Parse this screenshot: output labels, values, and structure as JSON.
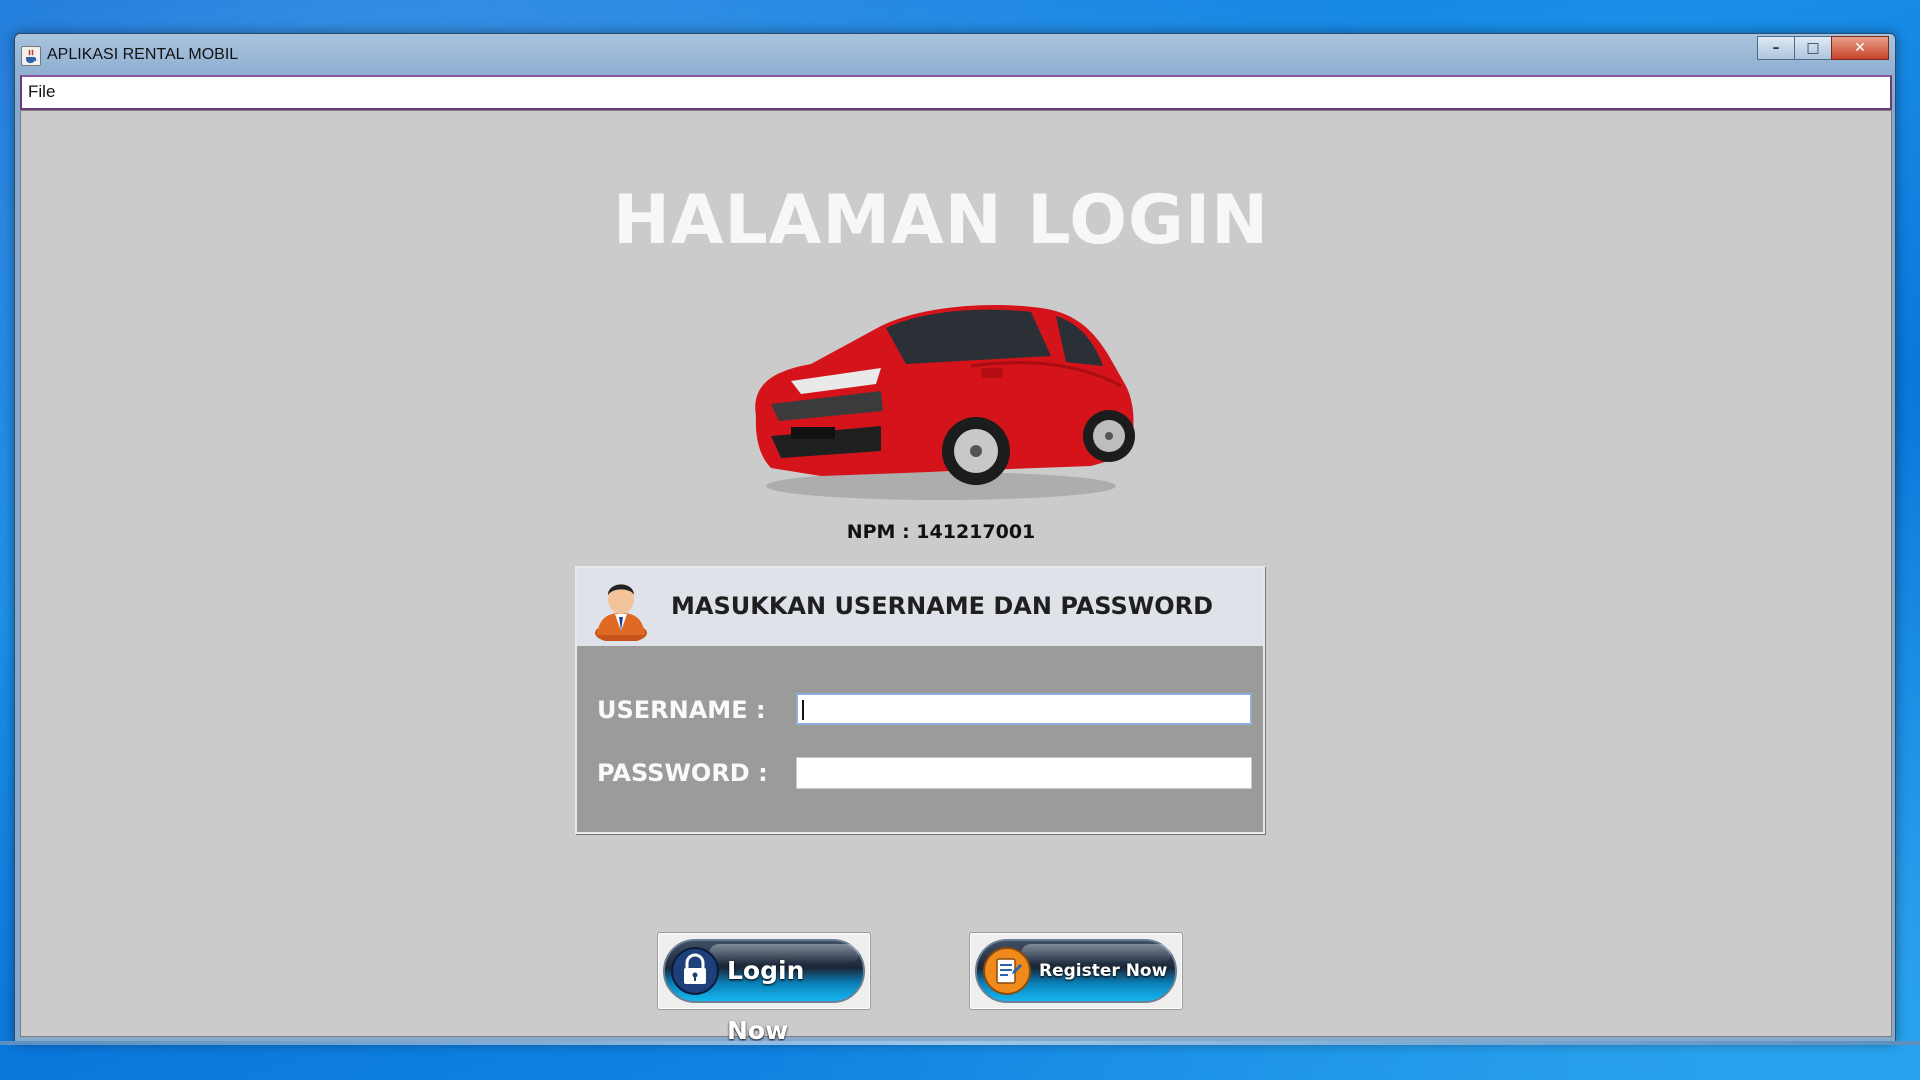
{
  "window": {
    "title": "APLIKASI RENTAL MOBIL",
    "controls": {
      "minimize": "–",
      "maximize": "□",
      "close": "✕"
    }
  },
  "menubar": {
    "items": [
      {
        "label": "File"
      }
    ]
  },
  "page": {
    "title": "HALAMAN LOGIN",
    "npm": "NPM : 141217001"
  },
  "login_panel": {
    "header": "MASUKKAN USERNAME DAN PASSWORD",
    "username_label": "USERNAME  :",
    "password_label": "PASSWORD :",
    "username_value": "",
    "password_value": ""
  },
  "buttons": {
    "login": "Login Now",
    "register": "Register Now"
  },
  "colors": {
    "content_bg": "#cbcbcb",
    "panel_bg": "#9b9b9b",
    "panel_header_bg": "#dfe2e8",
    "car_red": "#d4141a",
    "button_cyan": "#15b7f0",
    "register_icon_orange": "#f08a1c"
  },
  "icons": {
    "app": "java-app-icon",
    "user": "user-avatar-icon",
    "login": "padlock-icon",
    "register": "register-form-icon"
  }
}
